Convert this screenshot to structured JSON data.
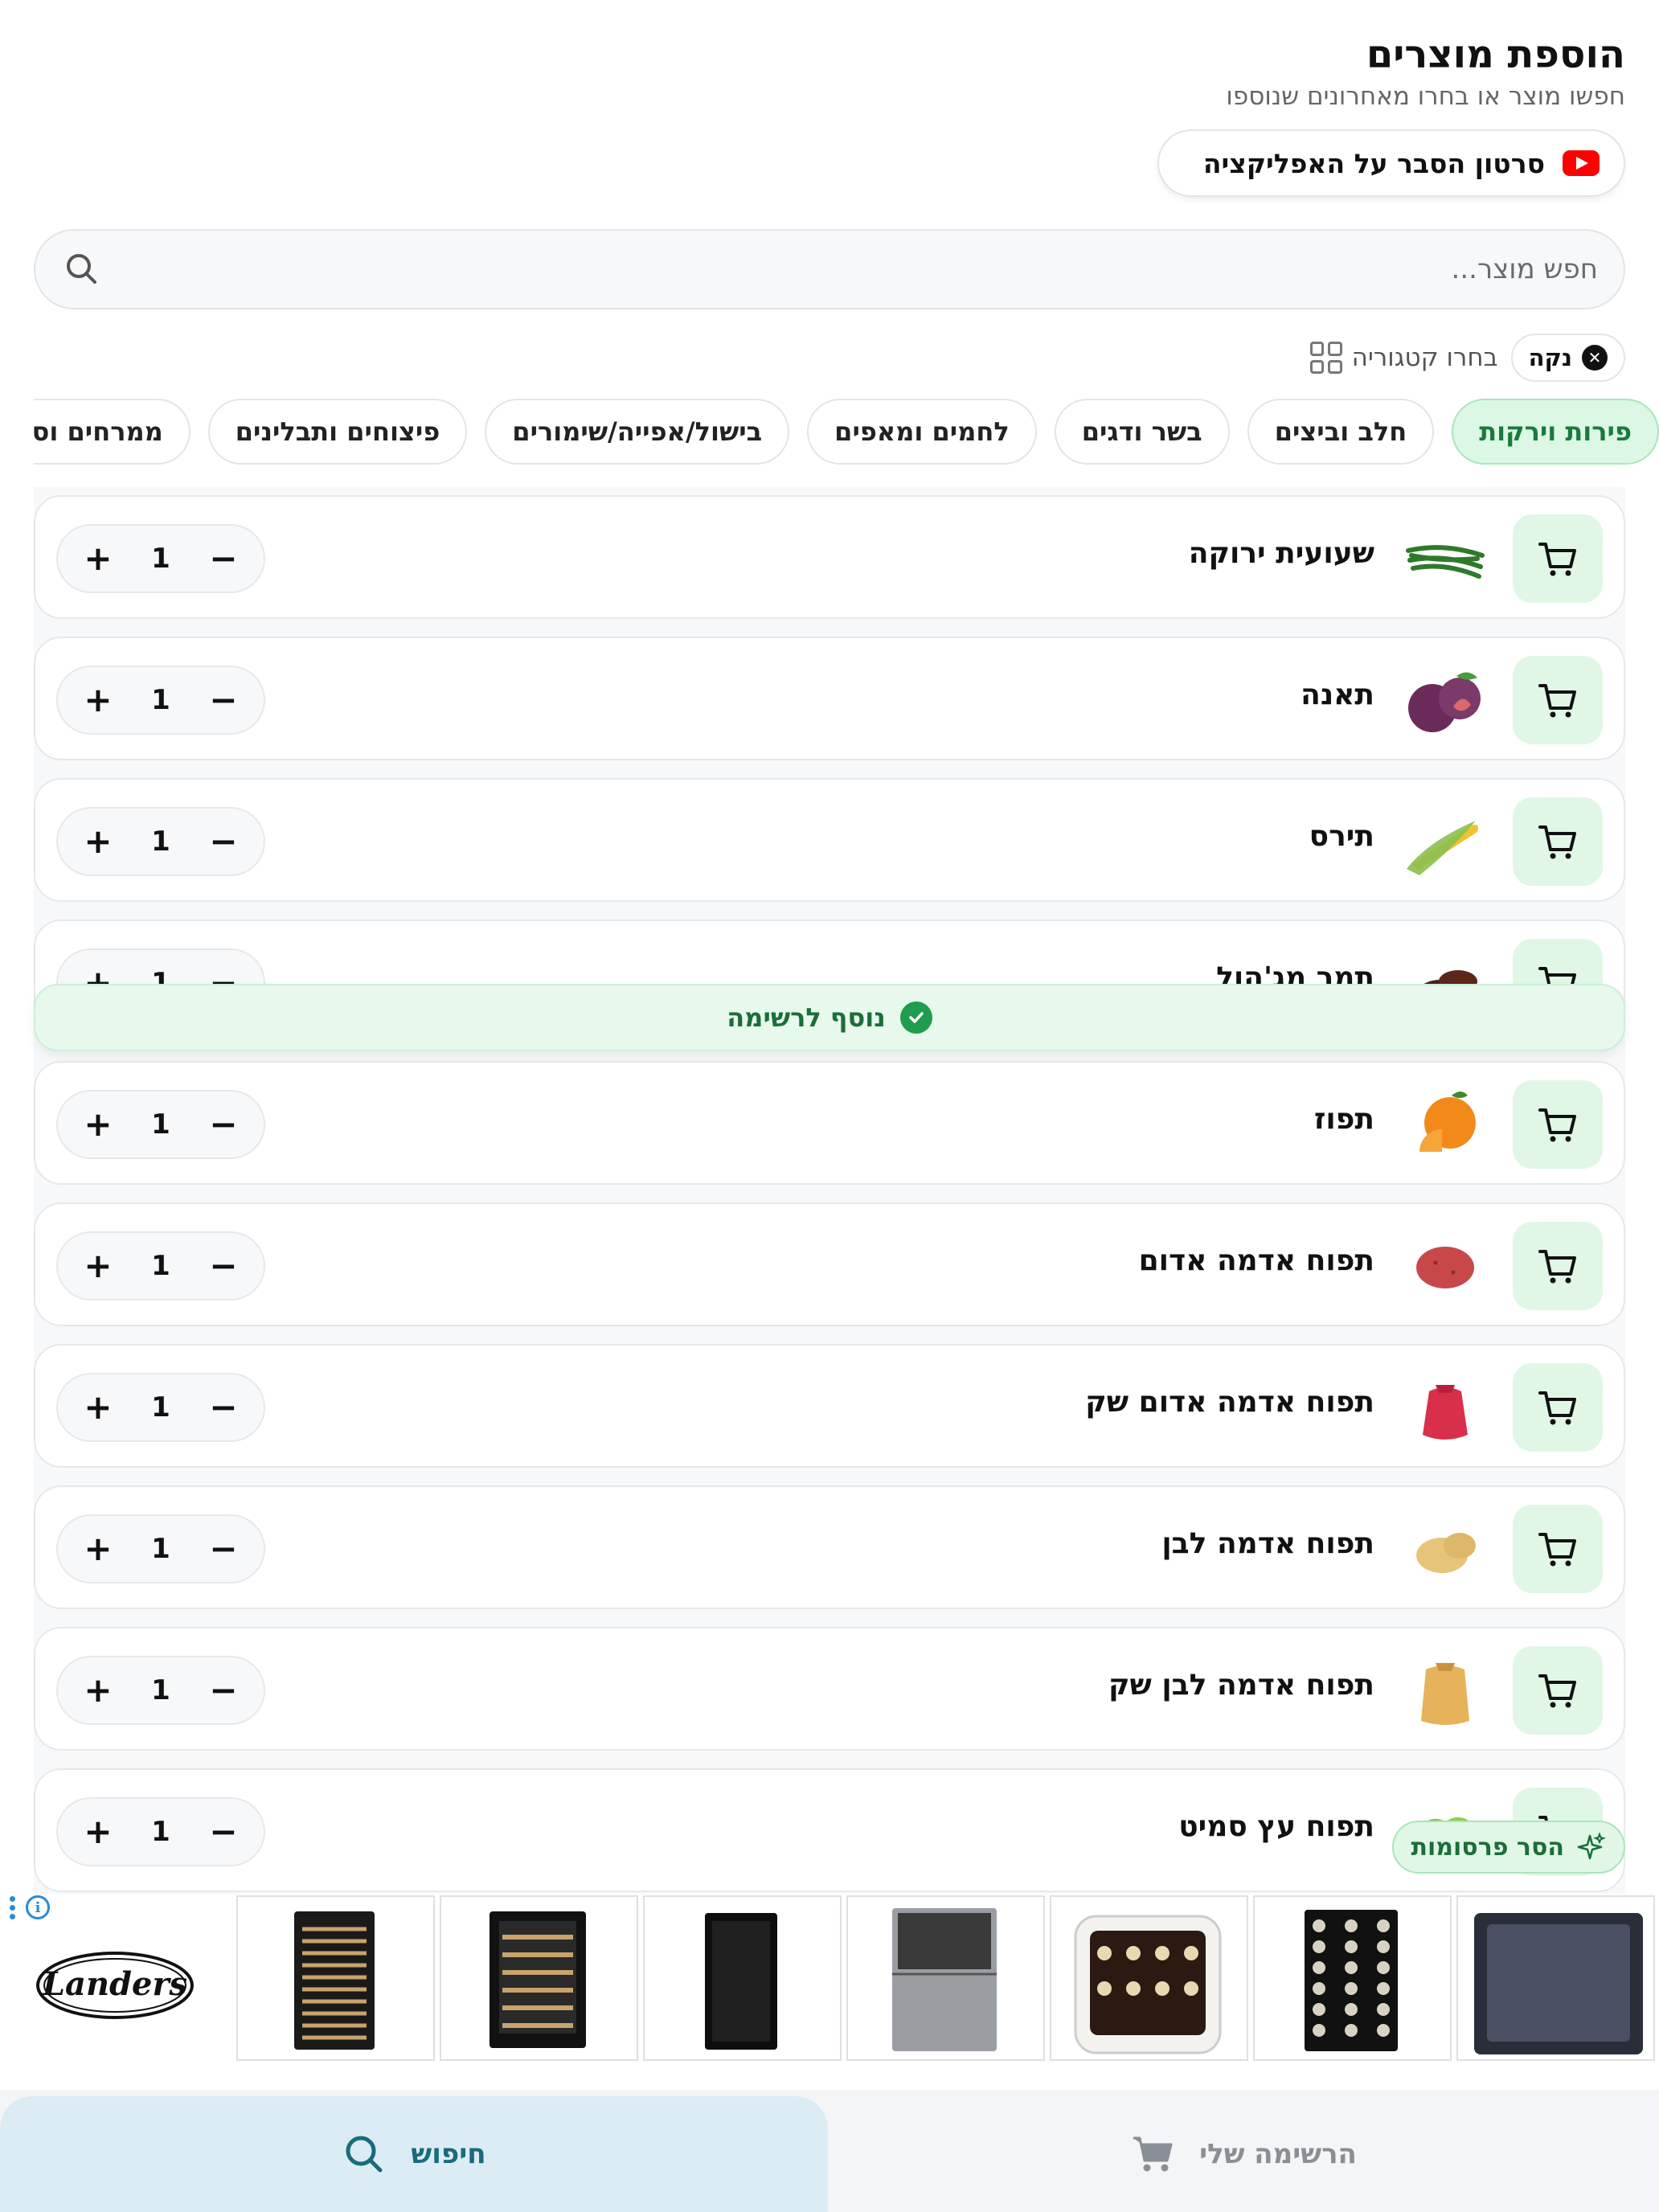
{
  "header": {
    "title": "הוספת מוצרים",
    "subtitle": "חפשו מוצר או בחרו מאחרונים שנוספו"
  },
  "video_button": {
    "label": "סרטון הסבר על האפליקציה",
    "icon": "youtube-icon"
  },
  "search": {
    "placeholder": "חפש מוצר...",
    "value": "",
    "icon": "search-icon"
  },
  "filters": {
    "active_filter": {
      "label": "נקה",
      "icon": "clear-icon"
    },
    "category_picker": {
      "label": "בחרו קטגוריה",
      "icon": "grid-icon"
    }
  },
  "categories": [
    {
      "label": "פירות וירקות",
      "active": true
    },
    {
      "label": "חלב וביצים",
      "active": false
    },
    {
      "label": "בשר ודגים",
      "active": false
    },
    {
      "label": "לחמים ומאפים",
      "active": false
    },
    {
      "label": "בישול/אפייה/שימורים",
      "active": false
    },
    {
      "label": "פיצוחים ותבלינים",
      "active": false
    },
    {
      "label": "ממרחים וסלטים",
      "active": false
    }
  ],
  "products": [
    {
      "name": "שעועית ירוקה",
      "qty": "1",
      "image": "green-beans"
    },
    {
      "name": "תאנה",
      "qty": "1",
      "image": "fig"
    },
    {
      "name": "תירס",
      "qty": "1",
      "image": "corn"
    },
    {
      "name": "תמר מג'הול",
      "qty": "1",
      "image": "dates"
    },
    {
      "name": "תפוז",
      "qty": "1",
      "image": "orange"
    },
    {
      "name": "תפוח אדמה אדום",
      "qty": "1",
      "image": "red-potato"
    },
    {
      "name": "תפוח אדמה אדום שק",
      "qty": "1",
      "image": "red-potato-sack"
    },
    {
      "name": "תפוח אדמה לבן",
      "qty": "1",
      "image": "white-potato"
    },
    {
      "name": "תפוח אדמה לבן שק",
      "qty": "1",
      "image": "white-potato-sack"
    },
    {
      "name": "תפוח עץ סמיט",
      "qty": "1",
      "image": "green-apple"
    }
  ],
  "stepper": {
    "plus": "+",
    "minus": "−"
  },
  "toast": {
    "label": "נוסף לרשימה",
    "icon": "check-circle-icon"
  },
  "remove_ads": {
    "label": "הסר פרסומות",
    "icon": "sparkle-icon"
  },
  "ad": {
    "brand": "Landers",
    "products": [
      "wine-fridge-1",
      "wine-fridge-2",
      "wine-fridge-3",
      "fridge-combo",
      "retro-wine-fridge",
      "wine-fridge-4",
      "wine-fridge-5"
    ]
  },
  "bottom_nav": {
    "search_tab": {
      "label": "חיפוש",
      "icon": "search-icon",
      "active": true
    },
    "list_tab": {
      "label": "הרשימה שלי",
      "icon": "cart-icon",
      "active": false
    }
  },
  "colors": {
    "accent_green": "#1a7a3c",
    "chip_green_bg": "#dcf7e3",
    "nav_active_bg": "#dcecf5",
    "nav_active_text": "#1a6b7d",
    "youtube_red": "#ff0000"
  }
}
